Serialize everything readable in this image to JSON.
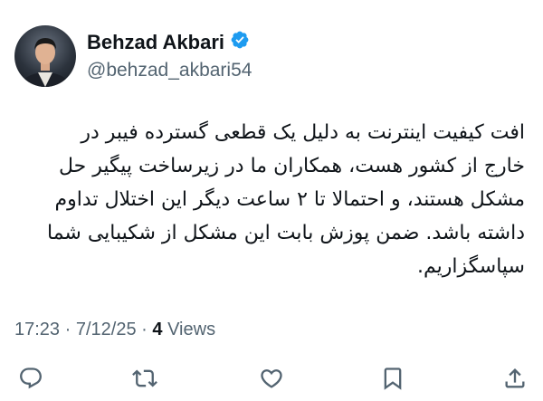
{
  "author": {
    "display_name": "Behzad Akbari",
    "handle": "@behzad_akbari54",
    "verified_icon": "verified-badge-icon",
    "verified_color": "#1d9bf0"
  },
  "tweet": {
    "text": "افت کیفیت اینترنت به دلیل یک قطعی گسترده فیبر در خارج از کشور هست، همکاران ما در زیرساخت پیگیر حل مشکل هستند، و احتمالا تا ۲ ساعت دیگر این اختلال تداوم داشته باشد. ضمن پوزش بابت این مشکل از شکیبایی شما سپاسگزاریم."
  },
  "meta": {
    "time": "17:23",
    "separator": "·",
    "date": "7/12/25",
    "views_count": "4",
    "views_label": "Views"
  },
  "actions": [
    {
      "name": "reply",
      "icon": "reply-icon"
    },
    {
      "name": "retweet",
      "icon": "retweet-icon"
    },
    {
      "name": "like",
      "icon": "heart-icon"
    },
    {
      "name": "bookmark",
      "icon": "bookmark-icon"
    },
    {
      "name": "share",
      "icon": "share-icon"
    }
  ],
  "colors": {
    "text_primary": "#0f1419",
    "text_secondary": "#536471",
    "icon_color": "#536471"
  }
}
